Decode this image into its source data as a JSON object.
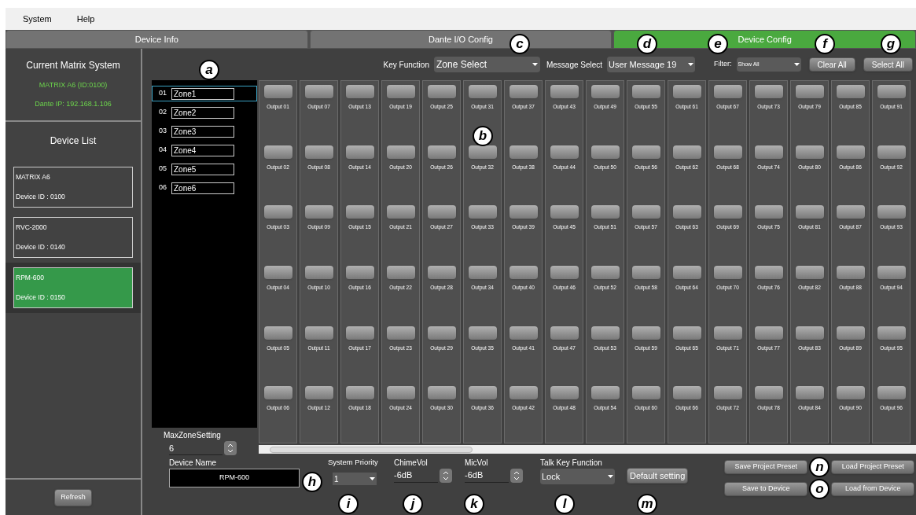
{
  "menu": [
    "System",
    "Help"
  ],
  "tabs": [
    {
      "label": "Device Info",
      "selected": false
    },
    {
      "label": "Dante I/O Config",
      "selected": false
    },
    {
      "label": "Device Config",
      "selected": true
    }
  ],
  "left_panel": {
    "title": "Current Matrix System",
    "system_name": "MATRIX A6 (ID:0100)",
    "dante_ip": "Dante IP: 192.168.1.106",
    "device_list_title": "Device List",
    "devices": [
      {
        "name": "MATRIX A6",
        "id": "Device ID :  0100",
        "selected": false
      },
      {
        "name": "RVC-2000",
        "id": "Device ID :  0140",
        "selected": false
      },
      {
        "name": "RPM-600",
        "id": "Device ID :  0150",
        "selected": true
      }
    ],
    "refresh": "Refresh"
  },
  "toolbar": {
    "key_function_label": "Key Function",
    "key_function_value": "Zone Select",
    "message_select_label": "Message Select",
    "message_select_value": "User Message 19",
    "filter_label": "Filter:",
    "filter_value": "Show All",
    "buttons": [
      "Clear All",
      "Select All"
    ]
  },
  "zones": [
    {
      "number": "01",
      "name": "Zone1",
      "selected": true
    },
    {
      "number": "02",
      "name": "Zone2",
      "selected": false
    },
    {
      "number": "03",
      "name": "Zone3",
      "selected": false
    },
    {
      "number": "04",
      "name": "Zone4",
      "selected": false
    },
    {
      "number": "05",
      "name": "Zone5",
      "selected": false
    },
    {
      "number": "06",
      "name": "Zone6",
      "selected": false
    }
  ],
  "max_zone": {
    "label": "MaxZoneSetting",
    "value": "6"
  },
  "outputs": [
    "Output 01",
    "Output 02",
    "Output 03",
    "Output 04",
    "Output 05",
    "Output 06",
    "Output 07",
    "Output 08",
    "Output 09",
    "Output 10",
    "Output 11",
    "Output 12",
    "Output 13",
    "Output 14",
    "Output 15",
    "Output 16",
    "Output 17",
    "Output 18",
    "Output 19",
    "Output 20",
    "Output 21",
    "Output 22",
    "Output 23",
    "Output 24",
    "Output 25",
    "Output 26",
    "Output 27",
    "Output 28",
    "Output 29",
    "Output 30",
    "Output 31",
    "Output 32",
    "Output 33",
    "Output 34",
    "Output 35",
    "Output 36",
    "Output 37",
    "Output 38",
    "Output 39",
    "Output 40",
    "Output 41",
    "Output 42",
    "Output 43",
    "Output 44",
    "Output 45",
    "Output 46",
    "Output 47",
    "Output 48",
    "Output 49",
    "Output 50",
    "Output 51",
    "Output 52",
    "Output 53",
    "Output 54",
    "Output 55",
    "Output 56",
    "Output 57",
    "Output 58",
    "Output 59",
    "Output 60",
    "Output 61",
    "Output 62",
    "Output 63",
    "Output 64",
    "Output 65",
    "Output 66",
    "Output 67",
    "Output 68",
    "Output 69",
    "Output 70",
    "Output 71",
    "Output 72",
    "Output 73",
    "Output 74",
    "Output 75",
    "Output 76",
    "Output 77",
    "Output 78",
    "Output 79",
    "Output 80",
    "Output 81",
    "Output 82",
    "Output 83",
    "Output 84",
    "Output 85",
    "Output 86",
    "Output 87",
    "Output 88",
    "Output 89",
    "Output 90",
    "Output 91",
    "Output 92",
    "Output 93",
    "Output 94",
    "Output 95",
    "Output 96"
  ],
  "bottom": {
    "device_name": {
      "label": "Device Name",
      "value": "RPM-600"
    },
    "system_priority": {
      "label": "System Priority",
      "value": "1"
    },
    "chime_vol": {
      "label": "ChimeVol",
      "value": "-6dB"
    },
    "mic_vol": {
      "label": "MicVol",
      "value": "-6dB"
    },
    "talk_key": {
      "label": "Talk Key Function",
      "value": "Lock"
    },
    "default_button": "Default setting",
    "preset_buttons": [
      "Save Project Preset",
      "Load Project Preset",
      "Save to Device",
      "Load from Device"
    ]
  },
  "callouts": [
    "a",
    "b",
    "c",
    "d",
    "e",
    "f",
    "g",
    "h",
    "i",
    "j",
    "k",
    "l",
    "m",
    "n",
    "o"
  ]
}
